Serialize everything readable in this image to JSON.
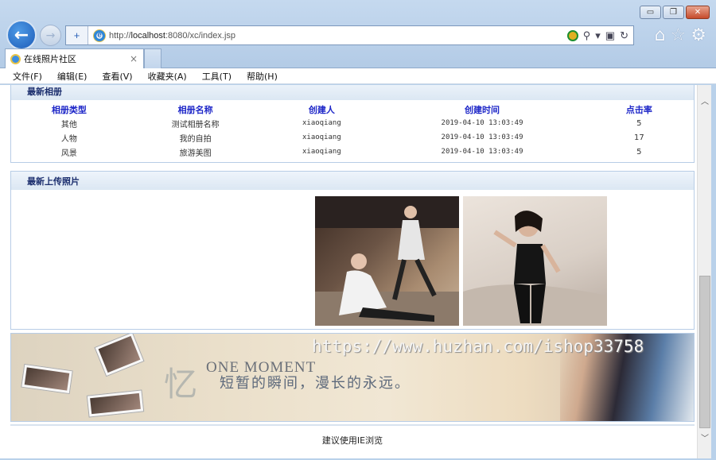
{
  "window": {
    "minimize_label": "▭",
    "restore_label": "❐",
    "close_label": "✕"
  },
  "nav": {
    "back_glyph": "←",
    "forward_glyph": "→"
  },
  "address": {
    "url_prefix": "http://",
    "url_host": "localhost",
    "url_rest": ":8080/xc/index.jsp"
  },
  "tab": {
    "title": "在线照片社区",
    "close_glyph": "×"
  },
  "menu": [
    "文件(F)",
    "编辑(E)",
    "查看(V)",
    "收藏夹(A)",
    "工具(T)",
    "帮助(H)"
  ],
  "albums_panel": {
    "title": "最新相册",
    "columns": [
      "相册类型",
      "相册名称",
      "创建人",
      "创建时间",
      "点击率"
    ],
    "rows": [
      [
        "其他",
        "测试相册名称",
        "xiaoqiang",
        "2019-04-10 13:03:49",
        "5"
      ],
      [
        "人物",
        "我的自拍",
        "xiaoqiang",
        "2019-04-10 13:03:49",
        "17"
      ],
      [
        "风景",
        "旅游美图",
        "xiaoqiang",
        "2019-04-10 13:03:49",
        "5"
      ]
    ]
  },
  "photos_panel": {
    "title": "最新上传照片"
  },
  "banner": {
    "char": "忆",
    "english": "ONE MOMENT",
    "chinese": "短暂的瞬间，漫长的永远。",
    "watermark": "https://www.huzhan.com/ishop33758"
  },
  "footer": {
    "text": "建议使用IE浏览"
  }
}
